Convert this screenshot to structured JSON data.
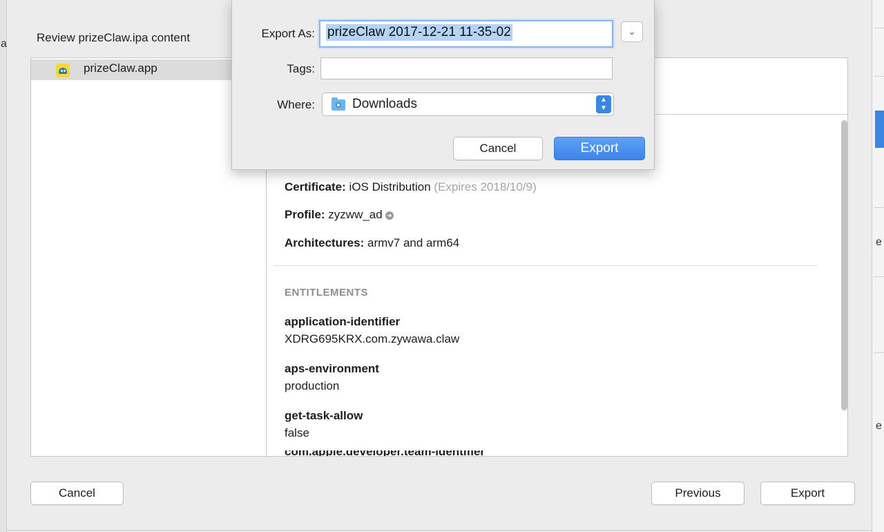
{
  "review": {
    "title": "Review prizeClaw.ipa content",
    "app_name": "prizeClaw.app"
  },
  "details": {
    "certificate_label": "Certificate:",
    "certificate_value": "iOS Distribution",
    "certificate_expiry": "(Expires 2018/10/9)",
    "profile_label": "Profile:",
    "profile_value": "zyzww_ad",
    "architectures_label": "Architectures:",
    "architectures_value": "armv7 and arm64"
  },
  "entitlements": {
    "header": "ENTITLEMENTS",
    "items": [
      {
        "key": "application-identifier",
        "value": "XDRG695KRX.com.zywawa.claw"
      },
      {
        "key": "aps-environment",
        "value": "production"
      },
      {
        "key": "get-task-allow",
        "value": "false"
      }
    ],
    "partial_key": "com.apple.developer.team-identifier"
  },
  "footer": {
    "cancel_label": "Cancel",
    "previous_label": "Previous",
    "export_label": "Export"
  },
  "save_dialog": {
    "export_as_label": "Export As:",
    "export_as_value": "prizeClaw 2017-12-21 11-35-02",
    "tags_label": "Tags:",
    "tags_value": "",
    "where_label": "Where:",
    "where_value": "Downloads",
    "cancel_label": "Cancel",
    "export_label": "Export"
  },
  "colors": {
    "accent": "#3b86e0",
    "selection": "#b4d3f7",
    "muted_text": "#a6a6a6"
  },
  "icons": {
    "app": "app-icon",
    "folder": "downloads-folder-icon",
    "expand": "chevron-down-icon",
    "popup": "up-down-stepper-icon",
    "profile_link": "arrow-circle-icon"
  }
}
